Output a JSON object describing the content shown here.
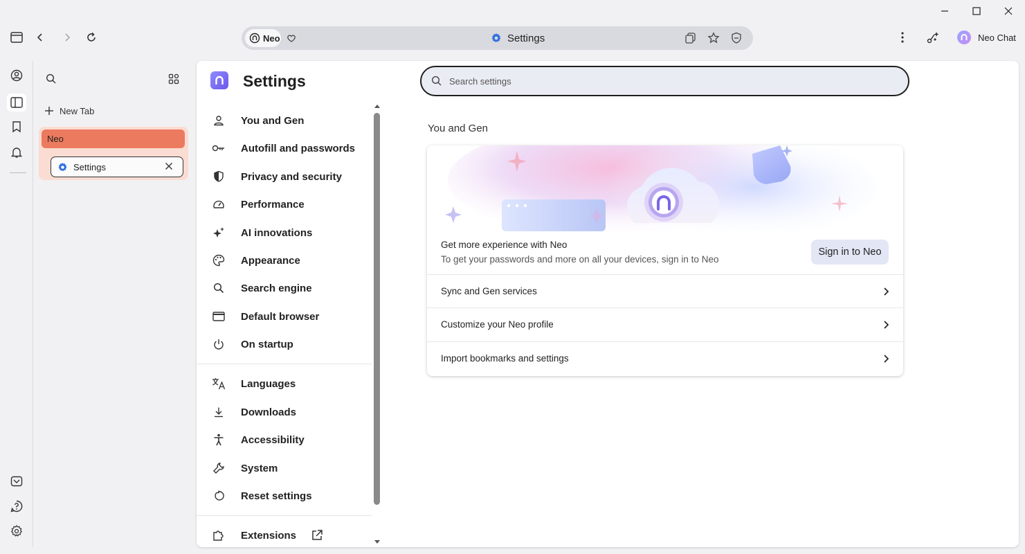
{
  "window": {
    "minimize_icon": "minimize-icon",
    "maximize_icon": "maximize-icon",
    "close_icon": "close-icon"
  },
  "toolbar": {
    "omnibox": {
      "chip_label": "Neo",
      "page_title": "Settings"
    },
    "profile_label": "Neo Chat"
  },
  "tabs_panel": {
    "new_tab_label": "New Tab",
    "group_label": "Neo",
    "tabs": [
      {
        "label": "Settings"
      }
    ]
  },
  "settings": {
    "title": "Settings",
    "search": {
      "placeholder": "Search settings",
      "value": ""
    },
    "nav_primary": [
      {
        "label": "You and Gen",
        "icon": "person-icon"
      },
      {
        "label": "Autofill and passwords",
        "icon": "key-icon"
      },
      {
        "label": "Privacy and security",
        "icon": "shield-icon"
      },
      {
        "label": "Performance",
        "icon": "speedometer-icon"
      },
      {
        "label": "AI innovations",
        "icon": "sparkle-icon"
      },
      {
        "label": "Appearance",
        "icon": "palette-icon"
      },
      {
        "label": "Search engine",
        "icon": "search-icon"
      },
      {
        "label": "Default browser",
        "icon": "browser-window-icon"
      },
      {
        "label": "On startup",
        "icon": "power-icon"
      }
    ],
    "nav_secondary": [
      {
        "label": "Languages",
        "icon": "translate-icon"
      },
      {
        "label": "Downloads",
        "icon": "download-icon"
      },
      {
        "label": "Accessibility",
        "icon": "accessibility-icon"
      },
      {
        "label": "System",
        "icon": "wrench-icon"
      },
      {
        "label": "Reset settings",
        "icon": "reset-icon"
      }
    ],
    "nav_extensions": {
      "label": "Extensions",
      "icon": "puzzle-icon"
    },
    "section_title": "You and Gen",
    "promo": {
      "headline": "Get more experience with Neo",
      "subtext": "To get your passwords and more on all your devices, sign in to Neo",
      "button_label": "Sign in to Neo"
    },
    "rows": [
      {
        "label": "Sync and Gen services"
      },
      {
        "label": "Customize your Neo profile"
      },
      {
        "label": "Import bookmarks and settings"
      }
    ]
  },
  "colors": {
    "accent": "#ec7a5e",
    "group_bg": "#fbdcd2",
    "brand_purple": "#7b6cf0",
    "gear_blue": "#2f6fe0"
  }
}
